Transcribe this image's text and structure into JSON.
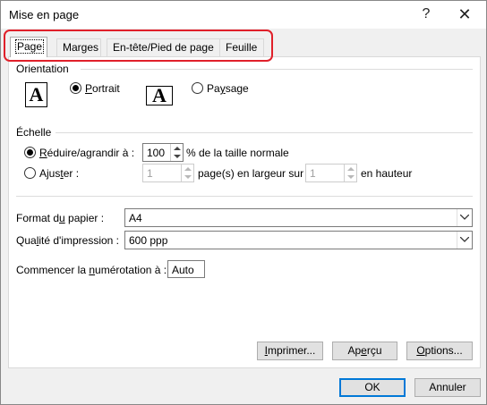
{
  "window": {
    "title": "Mise en page",
    "help_glyph": "?",
    "close_glyph": "✕"
  },
  "tabs": [
    {
      "label": "Page",
      "active": true
    },
    {
      "label": "Marges",
      "active": false
    },
    {
      "label": "En-tête/Pied de page",
      "active": false
    },
    {
      "label": "Feuille",
      "active": false
    }
  ],
  "orientation": {
    "heading": "Orientation",
    "portrait_pre": "",
    "portrait_key": "P",
    "portrait_post": "ortrait",
    "landscape_pre": "Pa",
    "landscape_key": "y",
    "landscape_post": "sage",
    "selected": "portrait",
    "icon_letter": "A"
  },
  "scaling": {
    "heading": "Échelle",
    "adjust_pre": "",
    "adjust_key": "R",
    "adjust_post": "éduire/agrandir à :",
    "adjust_value": "100",
    "adjust_suffix": "% de la taille normale",
    "fit_pre": "Ajus",
    "fit_key": "t",
    "fit_post": "er :",
    "fit_wide_value": "1",
    "fit_wide_suffix": "page(s) en largeur sur",
    "fit_tall_value": "1",
    "fit_tall_suffix": "en hauteur",
    "selected": "adjust"
  },
  "paper_size": {
    "label_pre": "Format d",
    "label_key": "u",
    "label_post": " papier :",
    "value": "A4"
  },
  "print_quality": {
    "label_pre": "Qua",
    "label_key": "l",
    "label_post": "ité d'impression :",
    "value": "600 ppp"
  },
  "first_page_number": {
    "label_pre": "Commencer la ",
    "label_key": "n",
    "label_post": "umérotation à :",
    "value": "Auto"
  },
  "buttons": {
    "print": {
      "pre": "",
      "key": "I",
      "post": "mprimer..."
    },
    "preview": {
      "pre": "Ap",
      "key": "e",
      "post": "rçu"
    },
    "options": {
      "pre": "",
      "key": "O",
      "post": "ptions..."
    },
    "ok": "OK",
    "cancel": "Annuler"
  },
  "colors": {
    "highlight": "#e0202a",
    "default_button": "#0078d7"
  }
}
